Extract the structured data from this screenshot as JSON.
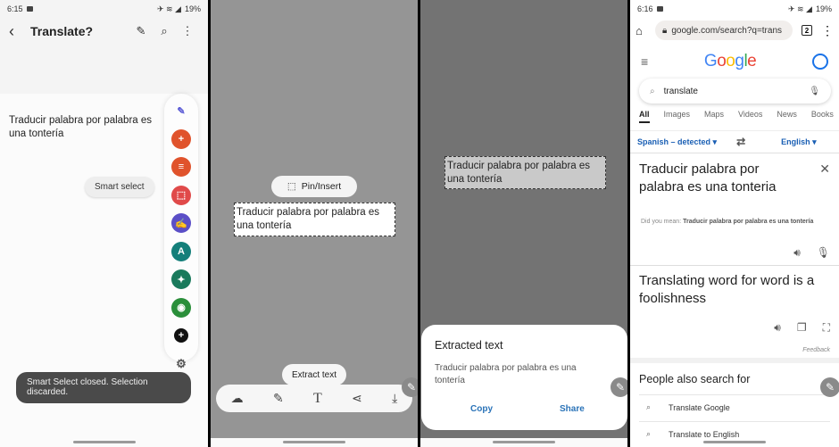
{
  "panel1": {
    "status": {
      "time": "6:15",
      "battery": "19%"
    },
    "appbar": {
      "title": "Translate?"
    },
    "note_text": "Traducir palabra por palabra es una tontería",
    "smart_select_label": "Smart select",
    "toast": "Smart Select closed. Selection discarded.",
    "edge_panel": {
      "items": [
        {
          "name": "pen-icon",
          "color": "#5b5bd6"
        },
        {
          "name": "add-note-icon",
          "color": "#e0532c"
        },
        {
          "name": "notes-icon",
          "color": "#e0532c"
        },
        {
          "name": "smart-select-icon",
          "color": "#e04a4a"
        },
        {
          "name": "write-icon",
          "color": "#5b4fc7"
        },
        {
          "name": "translate-icon",
          "color": "#147f7a"
        },
        {
          "name": "calendar-icon",
          "color": "#1a7a5c"
        },
        {
          "name": "eye-icon",
          "color": "#2a8f3a"
        },
        {
          "name": "add-icon",
          "color": "#111111"
        },
        {
          "name": "settings-icon",
          "color": "#555555"
        }
      ]
    }
  },
  "panel2": {
    "pin_insert_label": "Pin/Insert",
    "selection_text": "Traducir palabra por palabra es una tontería",
    "extract_text_label": "Extract text",
    "toolbar": [
      "lasso-icon",
      "pencil-icon",
      "text-icon",
      "share-icon",
      "save-icon"
    ]
  },
  "panel3": {
    "selection_text": "Traducir palabra por palabra es una tontería",
    "sheet": {
      "title": "Extracted text",
      "text": "Traducir palabra por palabra es una tontería",
      "copy_label": "Copy",
      "share_label": "Share"
    }
  },
  "panel4": {
    "status": {
      "time": "6:16",
      "battery": "19%"
    },
    "url": "google.com/search?q=trans",
    "tab_count": "2",
    "logo": [
      "G",
      "o",
      "o",
      "g",
      "l",
      "e"
    ],
    "logo_colors": [
      "#4285F4",
      "#EA4335",
      "#FBBC05",
      "#4285F4",
      "#34A853",
      "#EA4335"
    ],
    "search_query": "translate",
    "nav_tabs": [
      "All",
      "Images",
      "Maps",
      "Videos",
      "News",
      "Books"
    ],
    "source_lang": "Spanish – detected",
    "target_lang": "English",
    "source_text": "Traducir palabra por palabra es una tonteria",
    "did_you_mean_label": "Did you mean:",
    "did_you_mean_value": "Traducir palabra por palabra es una tontería",
    "output_text": "Translating word for word is a foolishness",
    "feedback_label": "Feedback",
    "people_also_search": "People also search for",
    "related": [
      "Translate Google",
      "Translate to English"
    ]
  }
}
